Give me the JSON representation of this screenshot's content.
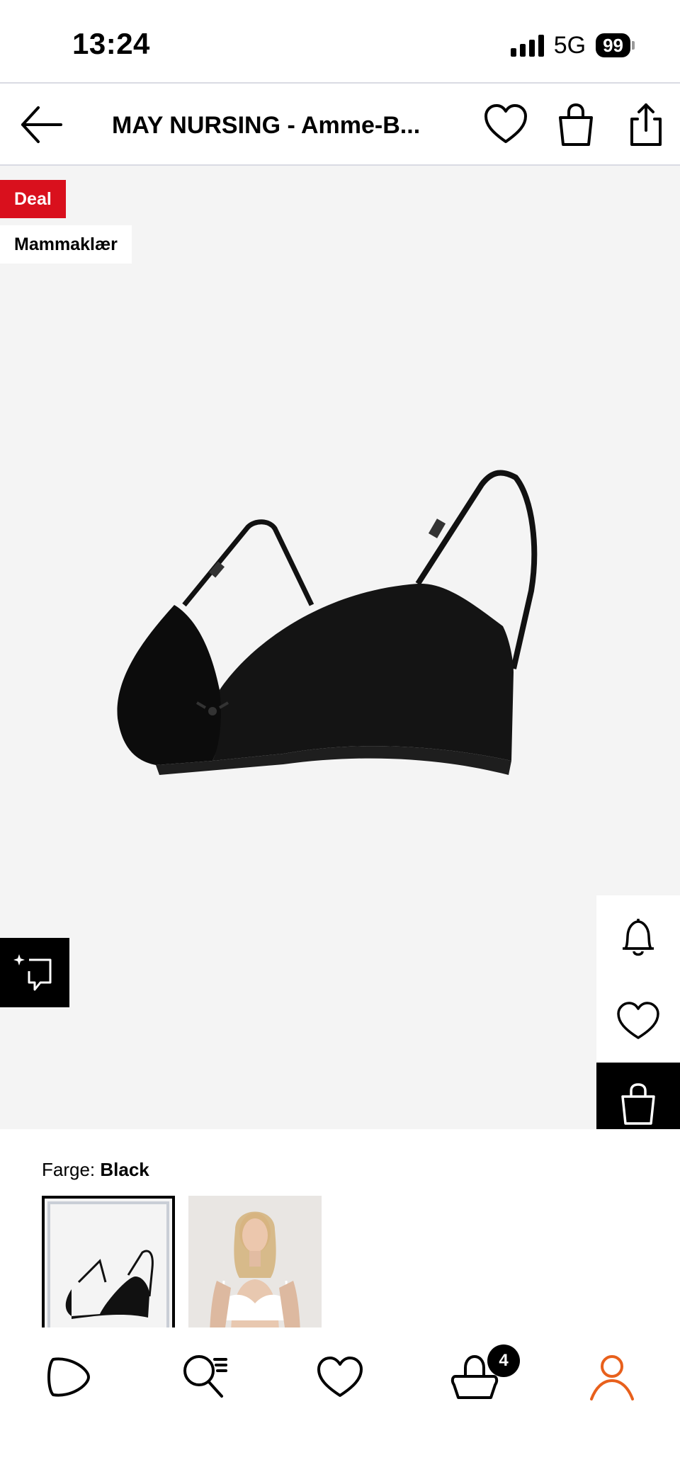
{
  "status_bar": {
    "time": "13:24",
    "network": "5G",
    "battery": "99"
  },
  "header": {
    "title": "MAY NURSING - Amme-B...",
    "icons": [
      "back-arrow-icon",
      "heart-icon",
      "bag-icon",
      "share-icon"
    ]
  },
  "product": {
    "badges": {
      "deal": "Deal",
      "category": "Mammaklær"
    },
    "side_actions": [
      "bell-icon",
      "heart-icon",
      "bag-icon"
    ],
    "ai_button_icon": "ai-sparkle-icon"
  },
  "color": {
    "label": "Farge:",
    "selected": "Black",
    "swatch_count": 2
  },
  "bottom_nav": {
    "items": [
      "play-icon",
      "search-icon",
      "heart-icon",
      "cart-icon",
      "profile-icon"
    ],
    "cart_count": "4",
    "active_color": "#e8601c"
  },
  "colors": {
    "deal_red": "#d9101d",
    "image_background": "#f4f4f4"
  }
}
